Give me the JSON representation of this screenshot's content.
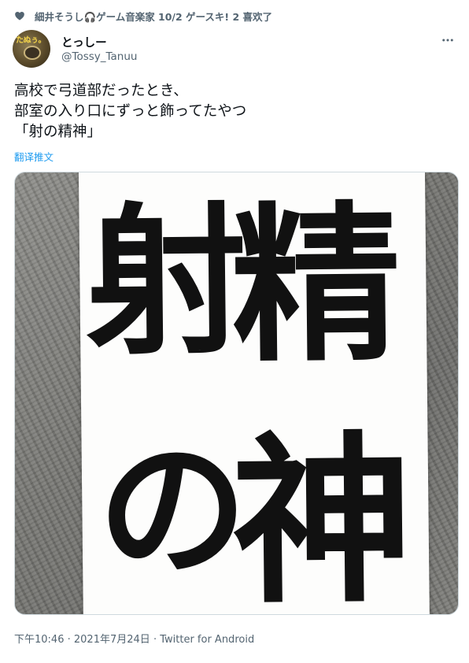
{
  "social_context": {
    "text": "細井そうし🎧ゲーム音楽家 10/2 ゲースキ! 2 喜欢了",
    "icon": "heart-icon"
  },
  "author": {
    "display_name": "とっしー",
    "handle": "@Tossy_Tanuu",
    "avatar_text": "たぬぅ。"
  },
  "tweet": {
    "text": "高校で弓道部だったとき、\n部室の入り口にずっと飾ってたやつ\n「射の精神」",
    "translate_label": "翻译推文"
  },
  "media": {
    "calligraphy": [
      "射",
      "精",
      "の",
      "神"
    ]
  },
  "meta": {
    "time": "下午10:46",
    "date": "2021年7月24日",
    "source": "Twitter for Android",
    "separator": "·"
  },
  "colors": {
    "text": "#0f1419",
    "secondary": "#536471",
    "link": "#1d9bf0"
  }
}
